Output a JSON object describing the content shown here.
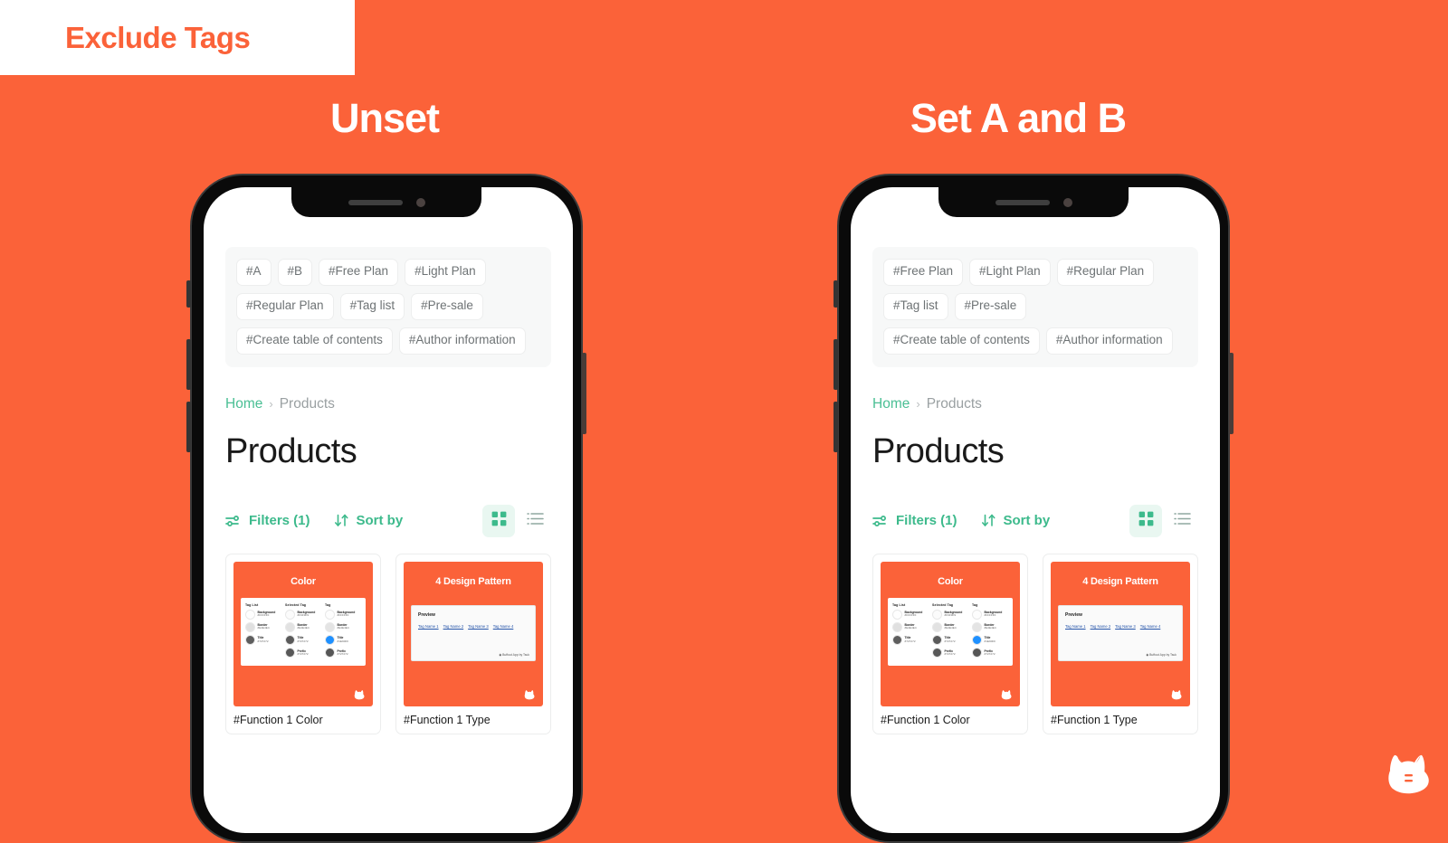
{
  "colors": {
    "background": "#FB6239",
    "banner_bg": "#FFFFFF",
    "accent_green": "#3DBA8C",
    "breadcrumb_link": "#4ABF94",
    "heading_white": "#FFFFFF"
  },
  "banner": {
    "title": "Exclude Tags"
  },
  "columns": [
    {
      "heading": "Unset"
    },
    {
      "heading": "Set A and B"
    }
  ],
  "phones": [
    {
      "label": "unset-phone",
      "tags": [
        "#A",
        "#B",
        "#Free Plan",
        "#Light Plan",
        "#Regular Plan",
        "#Tag list",
        "#Pre-sale",
        "#Create table of contents",
        "#Author information"
      ],
      "breadcrumb": {
        "home": "Home",
        "separator": "›",
        "current": "Products"
      },
      "page_title": "Products",
      "toolbar": {
        "filters_label": "Filters (1)",
        "sort_label": "Sort by",
        "grid_icon": "grid-view-icon",
        "list_icon": "list-view-icon",
        "active_view": "grid"
      },
      "cards": [
        {
          "thumb_title": "Color",
          "caption": "#Function 1 Color",
          "kind": "color",
          "swatch_groups": [
            {
              "title": "Tag List",
              "swatches": [
                {
                  "label": "Background",
                  "hex": "#FFFFFF",
                  "color": "#FEFEFE"
                },
                {
                  "label": "Border",
                  "hex": "#E4E4E4",
                  "color": "#E0E0E0"
                },
                {
                  "label": "Title",
                  "hex": "#727272",
                  "color": "#5E5E5E"
                }
              ]
            },
            {
              "title": "Selected Tag",
              "swatches": [
                {
                  "label": "Background",
                  "hex": "#F9F9F9",
                  "color": "#FBFBFB"
                },
                {
                  "label": "Border",
                  "hex": "#E4E4E4",
                  "color": "#E2E2E2"
                },
                {
                  "label": "Title",
                  "hex": "#727272",
                  "color": "#5A5A5A"
                },
                {
                  "label": "Prefix",
                  "hex": "#727272",
                  "color": "#585858"
                }
              ]
            },
            {
              "title": "Tag",
              "swatches": [
                {
                  "label": "Background",
                  "hex": "#FFFFFF",
                  "color": "#FDFDFD"
                },
                {
                  "label": "Border",
                  "hex": "#E4E4E4",
                  "color": "#E4E4E4"
                },
                {
                  "label": "Title",
                  "hex": "#1E90FF",
                  "color": "#1E90FF"
                },
                {
                  "label": "Prefix",
                  "hex": "#727272",
                  "color": "#565656"
                }
              ]
            }
          ]
        },
        {
          "thumb_title": "4 Design Pattern",
          "caption": "#Function 1 Type",
          "kind": "preview",
          "preview": {
            "title": "Preview",
            "links": [
              "Tag Name 1",
              "Tag Name 2",
              "Tag Name 3",
              "Tag Name 4"
            ],
            "credit": "◉ Buffout App by Tsuk"
          }
        }
      ]
    },
    {
      "label": "set-a-and-b-phone",
      "tags": [
        "#Free Plan",
        "#Light Plan",
        "#Regular Plan",
        "#Tag list",
        "#Pre-sale",
        "#Create table of contents",
        "#Author information"
      ],
      "breadcrumb": {
        "home": "Home",
        "separator": "›",
        "current": "Products"
      },
      "page_title": "Products",
      "toolbar": {
        "filters_label": "Filters (1)",
        "sort_label": "Sort by",
        "grid_icon": "grid-view-icon",
        "list_icon": "list-view-icon",
        "active_view": "grid"
      },
      "cards": [
        {
          "thumb_title": "Color",
          "caption": "#Function 1 Color",
          "kind": "color",
          "swatch_groups": [
            {
              "title": "Tag List",
              "swatches": [
                {
                  "label": "Background",
                  "hex": "#FFFFFF",
                  "color": "#FEFEFE"
                },
                {
                  "label": "Border",
                  "hex": "#E4E4E4",
                  "color": "#E0E0E0"
                },
                {
                  "label": "Title",
                  "hex": "#727272",
                  "color": "#5E5E5E"
                }
              ]
            },
            {
              "title": "Selected Tag",
              "swatches": [
                {
                  "label": "Background",
                  "hex": "#F9F9F9",
                  "color": "#FBFBFB"
                },
                {
                  "label": "Border",
                  "hex": "#E4E4E4",
                  "color": "#E2E2E2"
                },
                {
                  "label": "Title",
                  "hex": "#727272",
                  "color": "#5A5A5A"
                },
                {
                  "label": "Prefix",
                  "hex": "#727272",
                  "color": "#585858"
                }
              ]
            },
            {
              "title": "Tag",
              "swatches": [
                {
                  "label": "Background",
                  "hex": "#FFFFFF",
                  "color": "#FDFDFD"
                },
                {
                  "label": "Border",
                  "hex": "#E4E4E4",
                  "color": "#E4E4E4"
                },
                {
                  "label": "Title",
                  "hex": "#1E90FF",
                  "color": "#1E90FF"
                },
                {
                  "label": "Prefix",
                  "hex": "#727272",
                  "color": "#565656"
                }
              ]
            }
          ]
        },
        {
          "thumb_title": "4 Design Pattern",
          "caption": "#Function 1 Type",
          "kind": "preview",
          "preview": {
            "title": "Preview",
            "links": [
              "Tag Name 1",
              "Tag Name 2",
              "Tag Name 3",
              "Tag Name 4"
            ],
            "credit": "◉ Buffout App by Tsuk"
          }
        }
      ]
    }
  ],
  "mascot": {
    "icon": "dog-head-logo"
  }
}
